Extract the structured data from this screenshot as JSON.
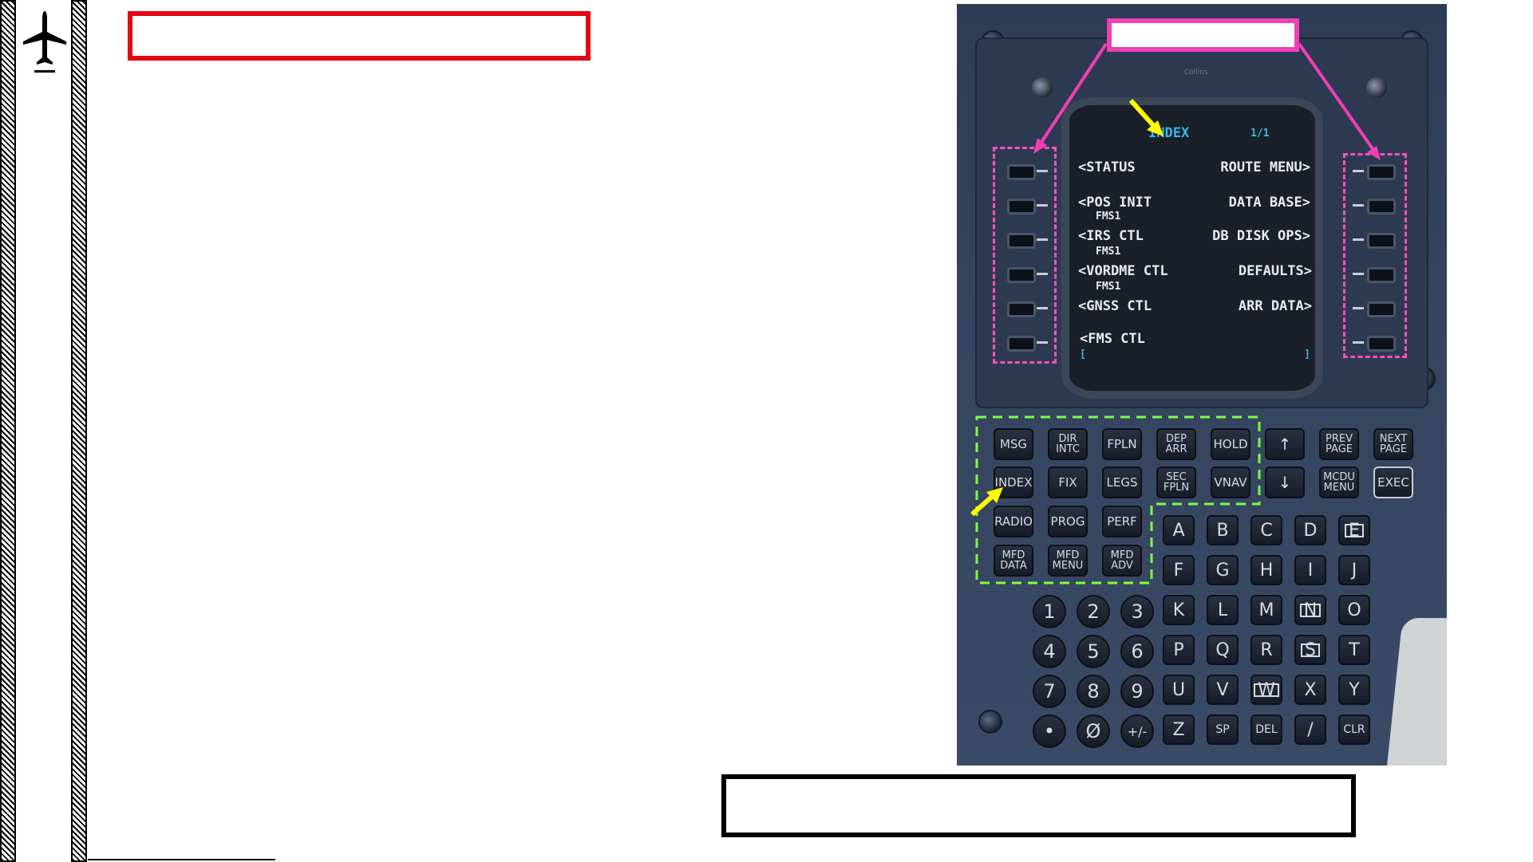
{
  "colors": {
    "title_box_border": "#e30613",
    "callout_magenta": "#f03fb8",
    "callout_green": "#7dff3d",
    "arrow_yellow": "#ffff00",
    "screen_cyan": "#35b8f0"
  },
  "icons": {
    "plane": "airplane-icon"
  },
  "mcdu": {
    "brand": "Collins",
    "screen": {
      "title": "INDEX",
      "page": "1/1",
      "left": [
        {
          "label": "<STATUS",
          "sub": ""
        },
        {
          "label": "<POS INIT",
          "sub": "FMS1"
        },
        {
          "label": "<IRS CTL",
          "sub": "FMS1"
        },
        {
          "label": "<VORDME CTL",
          "sub": "FMS1"
        },
        {
          "label": "<GNSS CTL",
          "sub": ""
        },
        {
          "label": "<FMS CTL",
          "sub": ""
        }
      ],
      "right": [
        "ROUTE MENU>",
        "DATA BASE>",
        "DB DISK OPS>",
        "DEFAULTS>",
        "ARR DATA>"
      ],
      "scratchpad_left": "[",
      "scratchpad_right": "]"
    },
    "function_keys": [
      [
        "MSG",
        "DIR INTC",
        "FPLN",
        "DEP ARR",
        "HOLD"
      ],
      [
        "INDEX",
        "FIX",
        "LEGS",
        "SEC FPLN",
        "VNAV"
      ],
      [
        "RADIO",
        "PROG",
        "PERF"
      ],
      [
        "MFD DATA",
        "MFD MENU",
        "MFD ADV"
      ]
    ],
    "page_keys": [
      "PREV PAGE",
      "NEXT PAGE",
      "MCDU MENU",
      "EXEC"
    ],
    "scroll_up": "↑",
    "scroll_down": "↓",
    "letters": [
      "A",
      "B",
      "C",
      "D",
      "E",
      "F",
      "G",
      "H",
      "I",
      "J",
      "K",
      "L",
      "M",
      "N",
      "O",
      "P",
      "Q",
      "R",
      "S",
      "T",
      "U",
      "V",
      "W",
      "X",
      "Y",
      "Z",
      "SP",
      "DEL",
      "/",
      "CLR"
    ],
    "digits": [
      "1",
      "2",
      "3",
      "4",
      "5",
      "6",
      "7",
      "8",
      "9",
      "•",
      "Ø",
      "+/-"
    ]
  }
}
